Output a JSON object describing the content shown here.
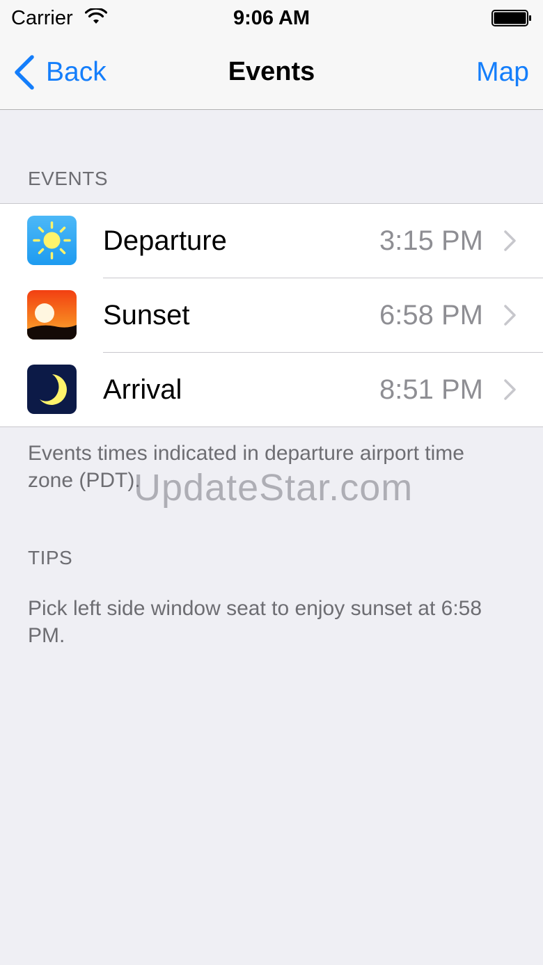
{
  "status_bar": {
    "carrier": "Carrier",
    "time": "9:06 AM"
  },
  "nav": {
    "back_label": "Back",
    "title": "Events",
    "right_label": "Map"
  },
  "events_section": {
    "header": "EVENTS",
    "rows": [
      {
        "icon": "sun-icon",
        "title": "Departure",
        "time": "3:15 PM"
      },
      {
        "icon": "sunset-icon",
        "title": "Sunset",
        "time": "6:58 PM"
      },
      {
        "icon": "moon-icon",
        "title": "Arrival",
        "time": "8:51 PM"
      }
    ],
    "footer": "Events times indicated in departure airport time zone (PDT)."
  },
  "tips_section": {
    "header": "TIPS",
    "text": "Pick left side window seat to enjoy sunset at 6:58 PM."
  },
  "watermark": "UpdateStar.com",
  "colors": {
    "tint": "#147efb",
    "background": "#efeff4",
    "secondary_text": "#8e8e93"
  }
}
